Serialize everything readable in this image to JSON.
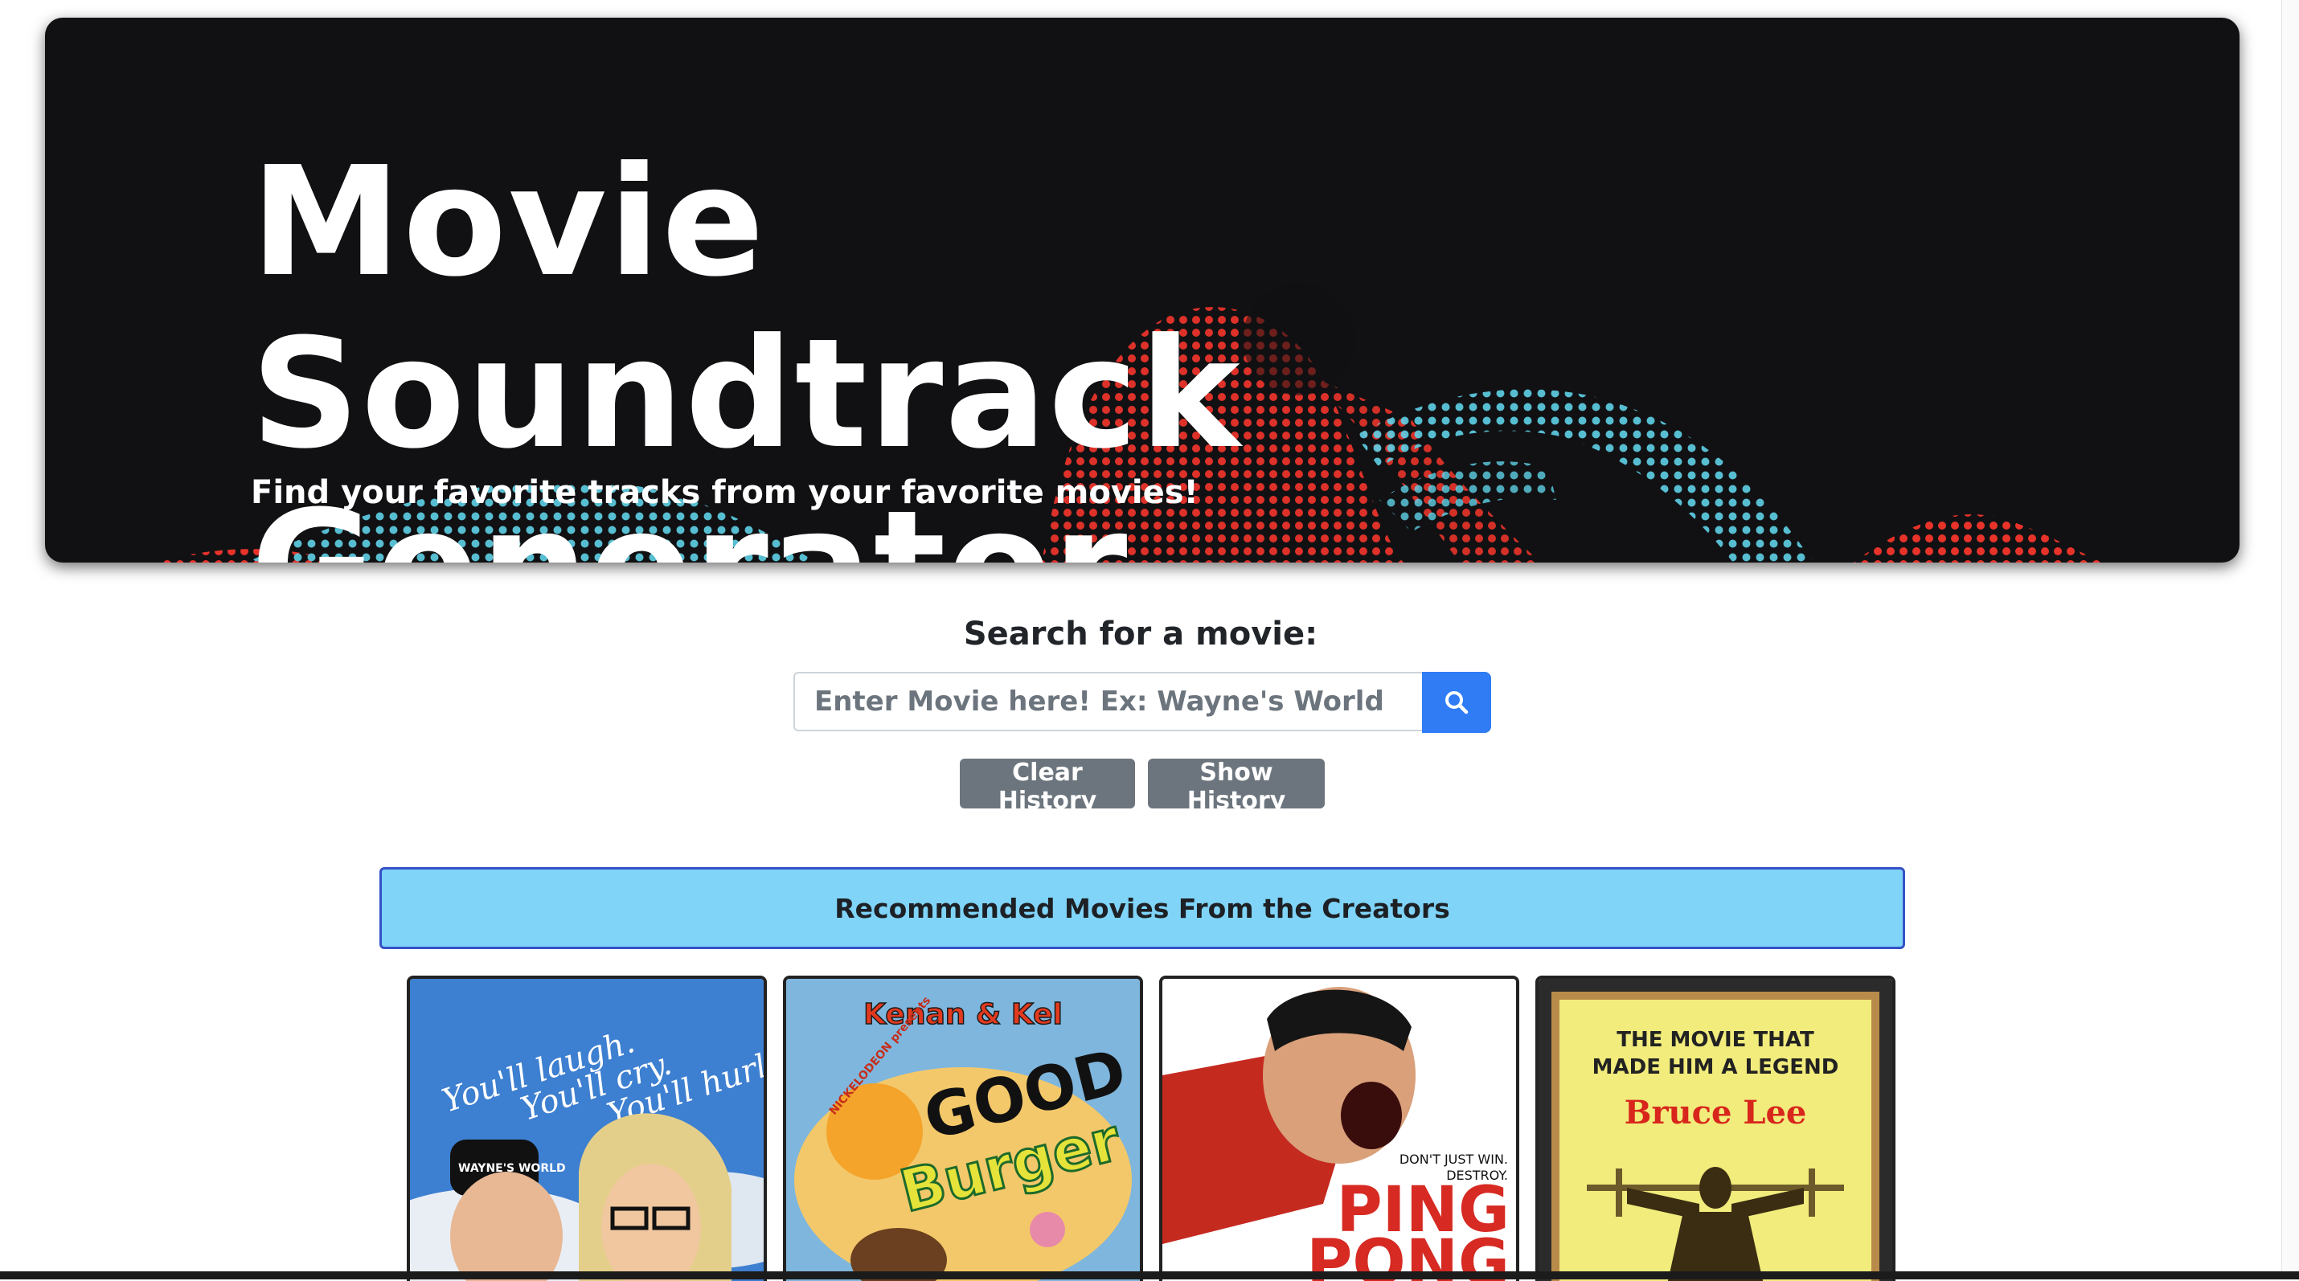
{
  "hero": {
    "title_line1": "Movie Soundtrack",
    "title_line2": "Generator",
    "subtitle": "Find your favorite tracks from your favorite movies!"
  },
  "search": {
    "label": "Search for a movie:",
    "placeholder": "Enter Movie here! Ex: Wayne's World",
    "button_icon": "search-icon"
  },
  "history": {
    "clear_label": "Clear History",
    "show_label": "Show History"
  },
  "recommended": {
    "heading": "Recommended Movies From the Creators",
    "movies": [
      {
        "poster_text": [
          "You'll laugh.",
          "You'll cry.",
          "You'll hurl!"
        ],
        "logo": "WAYNE'S WORLD"
      },
      {
        "poster_text": [
          "Kenan & Kel",
          "GOOD",
          "Burger"
        ],
        "logo": "NICKELODEON presents"
      },
      {
        "poster_text": [
          "DON'T JUST WIN.",
          "DESTROY.",
          "PING",
          "PONG"
        ]
      },
      {
        "poster_text": [
          "THE MOVIE THAT",
          "MADE HIM A LEGEND",
          "Bruce Lee"
        ]
      }
    ]
  },
  "colors": {
    "hero_bg": "#111113",
    "wave_red": "#e8332a",
    "wave_cyan": "#5fd0e6",
    "search_button": "#2f7cf4",
    "history_button": "#6c757d",
    "banner_bg": "#7fd4f8",
    "banner_border": "#3552c7"
  }
}
